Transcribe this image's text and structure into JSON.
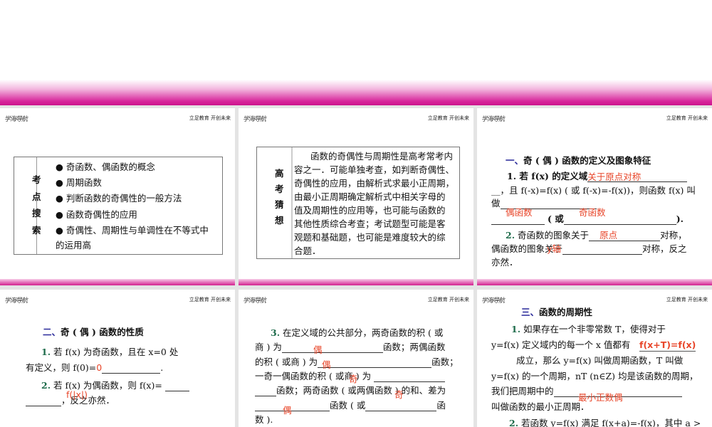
{
  "header": {
    "logo": "学海导航",
    "motto": "立足教育 开创未来"
  },
  "slide1": {
    "label": [
      "考",
      "点",
      "搜",
      "索"
    ],
    "bullet": "●",
    "items": [
      "奇函数、偶函数的概念",
      "周期函数",
      "判断函数的奇偶性的一般方法",
      "函数奇偶性的应用",
      "奇偶性、周期性与单调性在不等式中",
      "的运用高"
    ]
  },
  "slide2": {
    "label": [
      "高",
      "考",
      "猜",
      "想"
    ],
    "lines": [
      "函数的奇偶性与周期性是高考常考内",
      "容之一．可能单独考查，如判断奇偶性、",
      "奇偶性的应用，由解析式求最小正周期，",
      "由最小正周期确定解析式中相关字母的",
      "值及周期性的应用等，也可能与函数的",
      "其他性质综合考查；考试题型可能是客",
      "观题和基础题，也可能是难度较大的综",
      "合题．"
    ]
  },
  "slide3": {
    "title_num": "一、",
    "title": "奇 ( 偶 ) 函数的定义及图象特征",
    "l1": "1. 若 f(x) 的定义域",
    "a1": "关于原点对称",
    "l2": "__，且 f(-x)=f(x) ( 或 f(-x)=-f(x))，则函数 f(x) 叫",
    "l3": "做",
    "a2": "偶函数",
    "a3": "奇函数",
    "l4a": "( 或",
    "l4b": ").",
    "n2": "2.",
    "l5": "奇函数的图象关于",
    "a4": "原点",
    "l5b": "对称，",
    "l6": "偶函数的图象关于",
    "a5": "y轴",
    "l6b": "对称，反之",
    "l7": "亦然．"
  },
  "slide4": {
    "title_num": "二、",
    "title": "奇 ( 偶 ) 函数的性质",
    "n1": "1.",
    "l1": "若 f(x) 为奇函数，且在 x=0 处",
    "l2": "有定义，则 f(0)=",
    "a1": "0",
    "n2": "2.",
    "l3": "若 f(x) 为偶函数，则 f(x)=",
    "a2": "f(|x|)",
    "l4": "，反之亦然．"
  },
  "slide5": {
    "n3": "3.",
    "l1": "在定义域的公共部分，两奇函数的积 ( 或",
    "l2a": "商 ) 为",
    "a1": "偶",
    "l2b": "函数；两偶函数",
    "l3a": "的积 ( 或商 ) 为",
    "a2": "偶",
    "l3b": "函数；",
    "l4": "一奇一偶函数的积 ( 或商 ) 为",
    "a3": "奇",
    "l5": "函数；两奇函数 ( 或两偶函数 ) 的和、差为",
    "a4": "奇",
    "l6a": "函数 ( 或",
    "l6b": "函",
    "a5": "偶",
    "l7": "数 )."
  },
  "slide6": {
    "title_num": "三、",
    "title": "函数的周期性",
    "n1": "1.",
    "l1": "如果存在一个非零常数 T，使得对于",
    "l2": "y=f(x) 定义域内的每一个 x 值都有",
    "a1": "f(x+T)=f(x)",
    "l3": "成立，那么 y=f(x) 叫做周期函数，T 叫做",
    "l4": "y=f(x) 的一个周期，nT (n∈Z) 均是该函数的周期，",
    "l5": "我们把周期中的",
    "a2": "最小正数偶",
    "l6": "叫做函数的最小正周期．",
    "n2": "2.",
    "l7": "若函数 y=f(x) 满足 f(x+a)=-f(x)，其中 a >"
  }
}
